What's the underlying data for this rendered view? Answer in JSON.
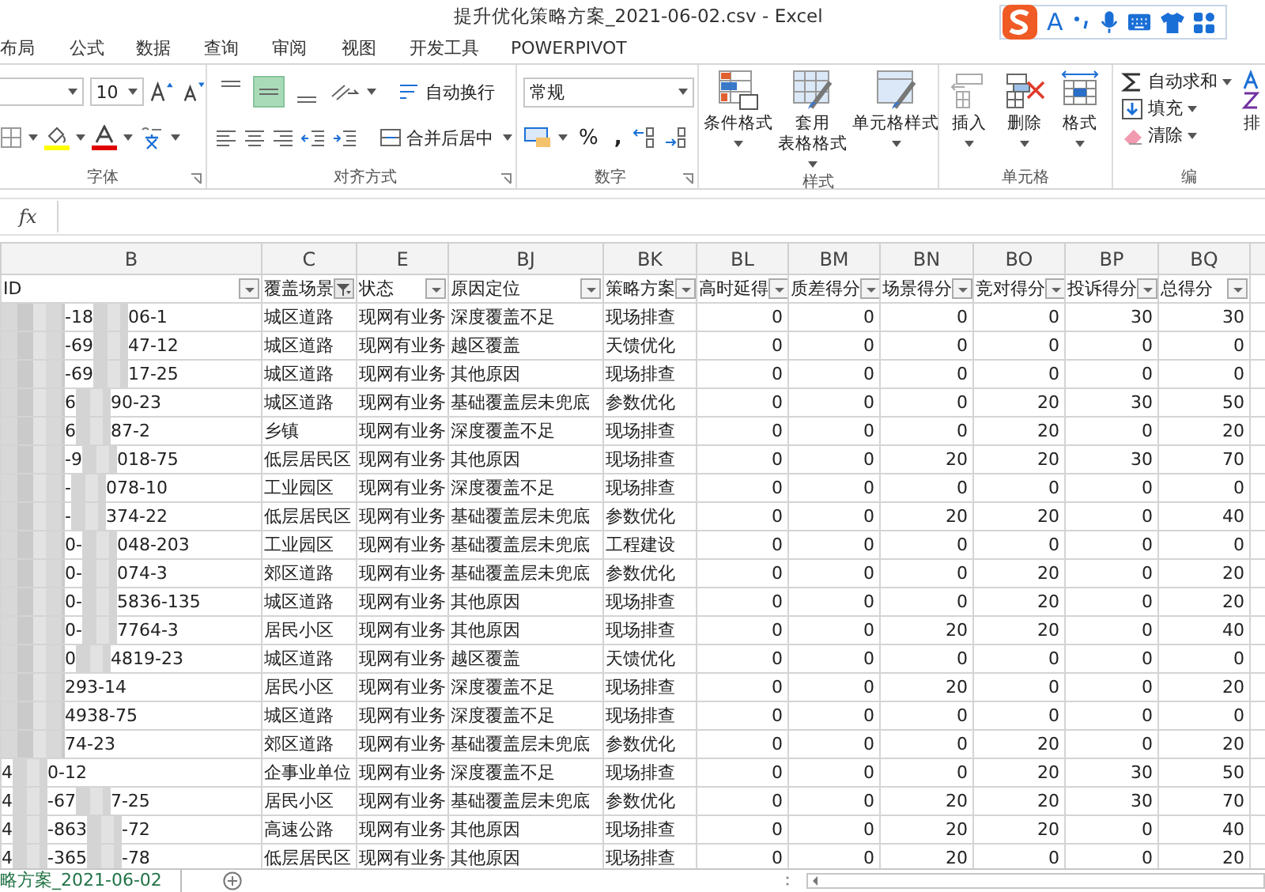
{
  "window": {
    "title": "提升优化策略方案_2021-06-02.csv - Excel"
  },
  "ime": {
    "mode": "A"
  },
  "menu": [
    {
      "label": "布局"
    },
    {
      "label": "公式"
    },
    {
      "label": "数据"
    },
    {
      "label": "查询"
    },
    {
      "label": "审阅"
    },
    {
      "label": "视图"
    },
    {
      "label": "开发工具"
    },
    {
      "label": "POWERPIVOT"
    }
  ],
  "ribbon": {
    "font_group": {
      "label": "字体",
      "font_size": "10"
    },
    "alignment_group": {
      "label": "对齐方式",
      "vertical_align": [
        {
          "kind": "top",
          "selected": false
        },
        {
          "kind": "middle",
          "selected": true
        },
        {
          "kind": "bottom",
          "selected": false
        }
      ],
      "wrap": "自动换行",
      "merge": "合并后居中"
    },
    "number_group": {
      "label": "数字",
      "format": "常规",
      "percent": "%",
      "comma": ","
    },
    "styles_group": {
      "label": "样式",
      "buttons": [
        {
          "kind": "conditional",
          "lines": [
            "条件格式"
          ]
        },
        {
          "kind": "table",
          "lines": [
            "套用",
            "表格格式"
          ]
        },
        {
          "kind": "cellstyle",
          "lines": [
            "单元格样式"
          ]
        }
      ]
    },
    "cells_group": {
      "label": "单元格",
      "buttons": [
        {
          "kind": "insert",
          "label": "插入"
        },
        {
          "kind": "delete",
          "label": "删除"
        },
        {
          "kind": "format",
          "label": "格式"
        }
      ]
    },
    "editing_group": {
      "label": "编",
      "items": [
        {
          "kind": "sum",
          "label": "自动求和"
        },
        {
          "kind": "fill",
          "label": "填充"
        },
        {
          "kind": "clear",
          "label": "清除"
        }
      ],
      "sort": "排"
    }
  },
  "formula_bar": {
    "fx": "fx"
  },
  "table": {
    "id_column": {
      "letter": "B",
      "header": "ID",
      "filtered": false
    },
    "columns": [
      {
        "letter": "C",
        "header": "覆盖场景",
        "kind": "text",
        "filtered": true
      },
      {
        "letter": "E",
        "header": "状态",
        "kind": "text",
        "filtered": false
      },
      {
        "letter": "BJ",
        "header": "原因定位",
        "kind": "text",
        "filtered": false
      },
      {
        "letter": "BK",
        "header": "策略方案",
        "kind": "text",
        "filtered": false
      },
      {
        "letter": "BL",
        "header": "高时延得",
        "kind": "number",
        "filtered": false
      },
      {
        "letter": "BM",
        "header": "质差得分",
        "kind": "number",
        "filtered": false
      },
      {
        "letter": "BN",
        "header": "场景得分",
        "kind": "number",
        "filtered": false
      },
      {
        "letter": "BO",
        "header": "竞对得分",
        "kind": "number",
        "filtered": false
      },
      {
        "letter": "BP",
        "header": "投诉得分",
        "kind": "number",
        "filtered": false
      },
      {
        "letter": "BQ",
        "header": "总得分",
        "kind": "number",
        "filtered": false
      }
    ],
    "rows": [
      {
        "lead_blur": true,
        "id": [
          "-18",
          "06-1"
        ],
        "cells": [
          "城区道路",
          "现网有业务",
          "深度覆盖不足",
          "现场排查",
          "0",
          "0",
          "0",
          "0",
          "30",
          "30"
        ]
      },
      {
        "lead_blur": true,
        "id": [
          "-69",
          "47-12"
        ],
        "cells": [
          "城区道路",
          "现网有业务",
          "越区覆盖",
          "天馈优化",
          "0",
          "0",
          "0",
          "0",
          "0",
          "0"
        ]
      },
      {
        "lead_blur": true,
        "id": [
          "-69",
          "17-25"
        ],
        "cells": [
          "城区道路",
          "现网有业务",
          "其他原因",
          "现场排查",
          "0",
          "0",
          "0",
          "0",
          "0",
          "0"
        ]
      },
      {
        "lead_blur": true,
        "id": [
          "6",
          "90-23"
        ],
        "cells": [
          "城区道路",
          "现网有业务",
          "基础覆盖层未兜底",
          "参数优化",
          "0",
          "0",
          "0",
          "20",
          "30",
          "50"
        ]
      },
      {
        "lead_blur": true,
        "id": [
          "6",
          "87-2"
        ],
        "cells": [
          "乡镇",
          "现网有业务",
          "深度覆盖不足",
          "现场排查",
          "0",
          "0",
          "0",
          "20",
          "0",
          "20"
        ]
      },
      {
        "lead_blur": true,
        "id": [
          "-9",
          "018-75"
        ],
        "cells": [
          "低层居民区",
          "现网有业务",
          "其他原因",
          "现场排查",
          "0",
          "0",
          "20",
          "20",
          "30",
          "70"
        ]
      },
      {
        "lead_blur": true,
        "id": [
          "-",
          "078-10"
        ],
        "cells": [
          "工业园区",
          "现网有业务",
          "深度覆盖不足",
          "现场排查",
          "0",
          "0",
          "0",
          "0",
          "0",
          "0"
        ]
      },
      {
        "lead_blur": true,
        "id": [
          "-",
          "374-22"
        ],
        "cells": [
          "低层居民区",
          "现网有业务",
          "基础覆盖层未兜底",
          "参数优化",
          "0",
          "0",
          "20",
          "20",
          "0",
          "40"
        ]
      },
      {
        "lead_blur": true,
        "id": [
          "0-",
          "048-203"
        ],
        "cells": [
          "工业园区",
          "现网有业务",
          "基础覆盖层未兜底",
          "工程建设",
          "0",
          "0",
          "0",
          "0",
          "0",
          "0"
        ]
      },
      {
        "lead_blur": true,
        "id": [
          "0-",
          "074-3"
        ],
        "cells": [
          "郊区道路",
          "现网有业务",
          "基础覆盖层未兜底",
          "参数优化",
          "0",
          "0",
          "0",
          "20",
          "0",
          "20"
        ]
      },
      {
        "lead_blur": true,
        "id": [
          "0-",
          "5836-135"
        ],
        "cells": [
          "城区道路",
          "现网有业务",
          "其他原因",
          "现场排查",
          "0",
          "0",
          "0",
          "20",
          "0",
          "20"
        ]
      },
      {
        "lead_blur": true,
        "id": [
          "0-",
          "7764-3"
        ],
        "cells": [
          "居民小区",
          "现网有业务",
          "其他原因",
          "现场排查",
          "0",
          "0",
          "20",
          "20",
          "0",
          "40"
        ]
      },
      {
        "lead_blur": true,
        "id": [
          "0",
          "4819-23"
        ],
        "cells": [
          "城区道路",
          "现网有业务",
          "越区覆盖",
          "天馈优化",
          "0",
          "0",
          "0",
          "0",
          "0",
          "0"
        ]
      },
      {
        "lead_blur": true,
        "id": [
          "293-14"
        ],
        "cells": [
          "居民小区",
          "现网有业务",
          "深度覆盖不足",
          "现场排查",
          "0",
          "0",
          "20",
          "0",
          "0",
          "20"
        ]
      },
      {
        "lead_blur": true,
        "id": [
          "4938-75"
        ],
        "cells": [
          "城区道路",
          "现网有业务",
          "深度覆盖不足",
          "现场排查",
          "0",
          "0",
          "0",
          "0",
          "0",
          "0"
        ]
      },
      {
        "lead_blur": true,
        "id": [
          "74-23"
        ],
        "cells": [
          "郊区道路",
          "现网有业务",
          "基础覆盖层未兜底",
          "参数优化",
          "0",
          "0",
          "0",
          "20",
          "0",
          "20"
        ]
      },
      {
        "lead_blur": false,
        "id": [
          "4",
          "0-12"
        ],
        "cells": [
          "企事业单位",
          "现网有业务",
          "深度覆盖不足",
          "现场排查",
          "0",
          "0",
          "0",
          "20",
          "30",
          "50"
        ]
      },
      {
        "lead_blur": false,
        "id": [
          "4",
          "-67",
          "7-25"
        ],
        "cells": [
          "居民小区",
          "现网有业务",
          "基础覆盖层未兜底",
          "参数优化",
          "0",
          "0",
          "20",
          "20",
          "30",
          "70"
        ]
      },
      {
        "lead_blur": false,
        "id": [
          "4",
          "-863",
          "-72"
        ],
        "cells": [
          "高速公路",
          "现网有业务",
          "其他原因",
          "现场排查",
          "0",
          "0",
          "20",
          "20",
          "0",
          "40"
        ]
      },
      {
        "lead_blur": false,
        "id": [
          "4",
          "-365",
          "-78"
        ],
        "cells": [
          "低层居民区",
          "现网有业务",
          "其他原因",
          "现场排查",
          "0",
          "0",
          "20",
          "0",
          "0",
          "20"
        ]
      }
    ]
  },
  "sheet_tabs": [
    {
      "label": "略方案_2021-06-02",
      "selected": true
    }
  ]
}
